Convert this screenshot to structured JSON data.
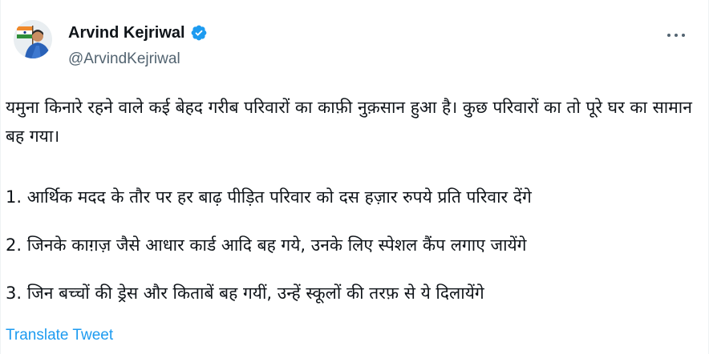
{
  "author": {
    "display_name": "Arvind Kejriwal",
    "handle": "@ArvindKejriwal",
    "verified_badge_icon": "verified-badge-icon",
    "badge_color": "#1d9bf0"
  },
  "more_icon": "more-options-icon",
  "tweet": {
    "intro": "यमुना किनारे रहने वाले कई बेहद गरीब परिवारों का काफ़ी नुक़सान हुआ है। कुछ परिवारों का तो पूरे घर का सामान बह गया।",
    "point_1": "1. आर्थिक मदद के तौर पर हर बाढ़ पीड़ित परिवार को दस हज़ार रुपये प्रति परिवार देंगे",
    "point_2": "2. जिनके काग़ज़ जैसे आधार कार्ड आदि बह गये, उनके लिए स्पेशल कैंप लगाए जायेंगे",
    "point_3": "3. जिन बच्चों की ड्रेस और किताबें बह गयीं, उन्हें स्कूलों की तरफ़ से ये दिलायेंगे"
  },
  "translate_label": "Translate Tweet",
  "colors": {
    "text_primary": "#0f1419",
    "text_secondary": "#536471",
    "link": "#1d9bf0"
  }
}
